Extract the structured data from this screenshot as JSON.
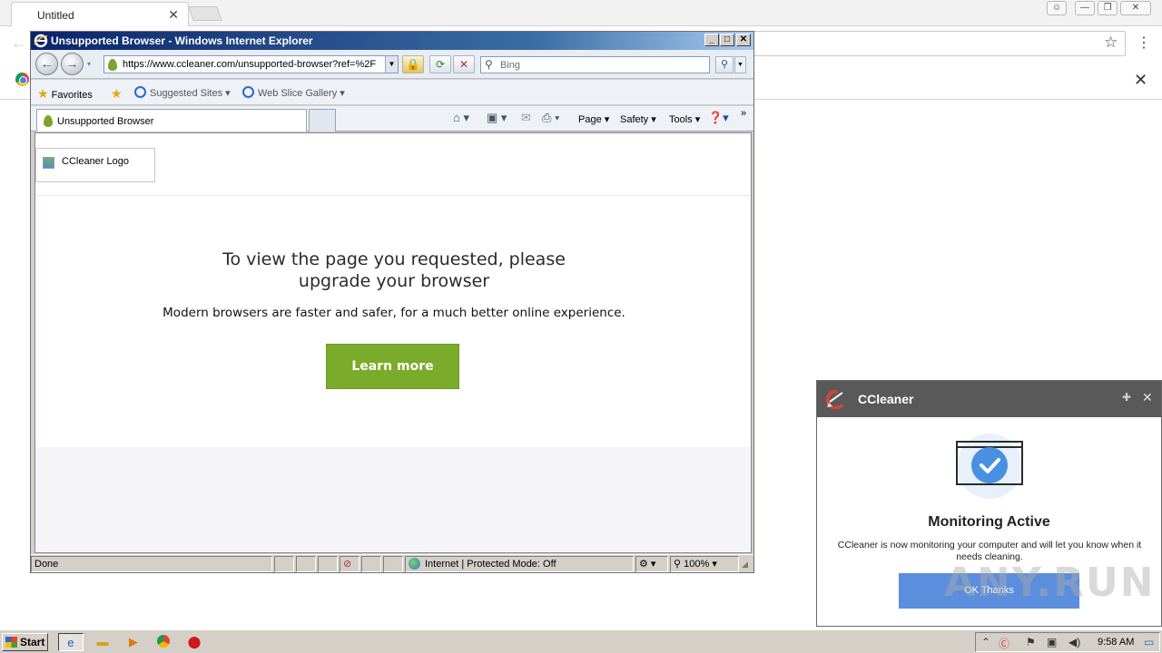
{
  "chrome": {
    "tab_title": "Untitled",
    "tab_close": "✕",
    "back_icon": "←",
    "star_icon": "☆",
    "menu_icon": "⋮",
    "infobar_close": "✕",
    "win_controls": [
      "☃",
      "—",
      "❐",
      "✕"
    ]
  },
  "ie": {
    "window_title": "Unsupported Browser - Windows Internet Explorer",
    "title_controls": {
      "minimize": "_",
      "maximize": "□",
      "close": "✕"
    },
    "nav": {
      "back_icon": "←",
      "forward_icon": "→",
      "address": "https://www.ccleaner.com/unsupported-browser?ref=%2F",
      "lock_icon": "🔒",
      "refresh_icon": "⟳",
      "stop_icon": "✕",
      "search_placeholder": "Bing",
      "search_icon": "⚲"
    },
    "favorites": {
      "favorites_label": "Favorites",
      "suggested_sites": "Suggested Sites ▾",
      "web_slice_gallery": "Web Slice Gallery ▾"
    },
    "command_bar": {
      "tab_label": "Unsupported Browser",
      "page": "Page ▾",
      "safety": "Safety ▾",
      "tools": "Tools ▾",
      "chevron": "»"
    },
    "content": {
      "logo_alt": "CCleaner Logo",
      "heading_line1": "To view the page you requested, please",
      "heading_line2": "upgrade your browser",
      "subtext": "Modern browsers are faster and safer, for a much better online experience.",
      "learn_more": "Learn more"
    },
    "status": {
      "text": "Done",
      "zone": "Internet | Protected Mode: Off",
      "zoom": "100%"
    }
  },
  "ccleaner_popup": {
    "title": "CCleaner",
    "heading": "Monitoring Active",
    "message": "CCleaner is now monitoring your computer and will let you know when it needs cleaning.",
    "ok_button": "OK Thanks",
    "pin_icon": "📌",
    "close_icon": "✕"
  },
  "watermark": "ANY.RUN",
  "taskbar": {
    "start_label": "Start",
    "clock": "9:58 AM"
  },
  "colors": {
    "learn_more_green": "#7aab2a",
    "cc_header": "#595959",
    "cc_button": "#5b8edc",
    "ie_title_blue": "#0a246a"
  }
}
